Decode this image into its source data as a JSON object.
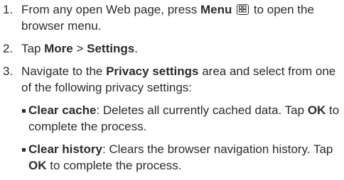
{
  "steps": [
    {
      "num": "1.",
      "pre": "From any open Web page, press ",
      "bold": "Menu",
      "post": " to open the browser menu.",
      "icon": "menu-key-icon"
    },
    {
      "num": "2.",
      "pre": "Tap ",
      "bold1": "More",
      "sep": " > ",
      "bold2": "Settings",
      "post": "."
    },
    {
      "num": "3.",
      "pre": "Navigate to the ",
      "bold": "Privacy settings",
      "post": " area and select from one of the following privacy settings:"
    }
  ],
  "options": [
    {
      "title": "Clear cache",
      "desc_pre": ": Deletes all currently cached data. Tap ",
      "ok": "OK",
      "desc_post": " to complete the process."
    },
    {
      "title": "Clear history",
      "desc_pre": ": Clears the browser navigation history. Tap ",
      "ok": "OK",
      "desc_post": " to complete the process."
    }
  ]
}
